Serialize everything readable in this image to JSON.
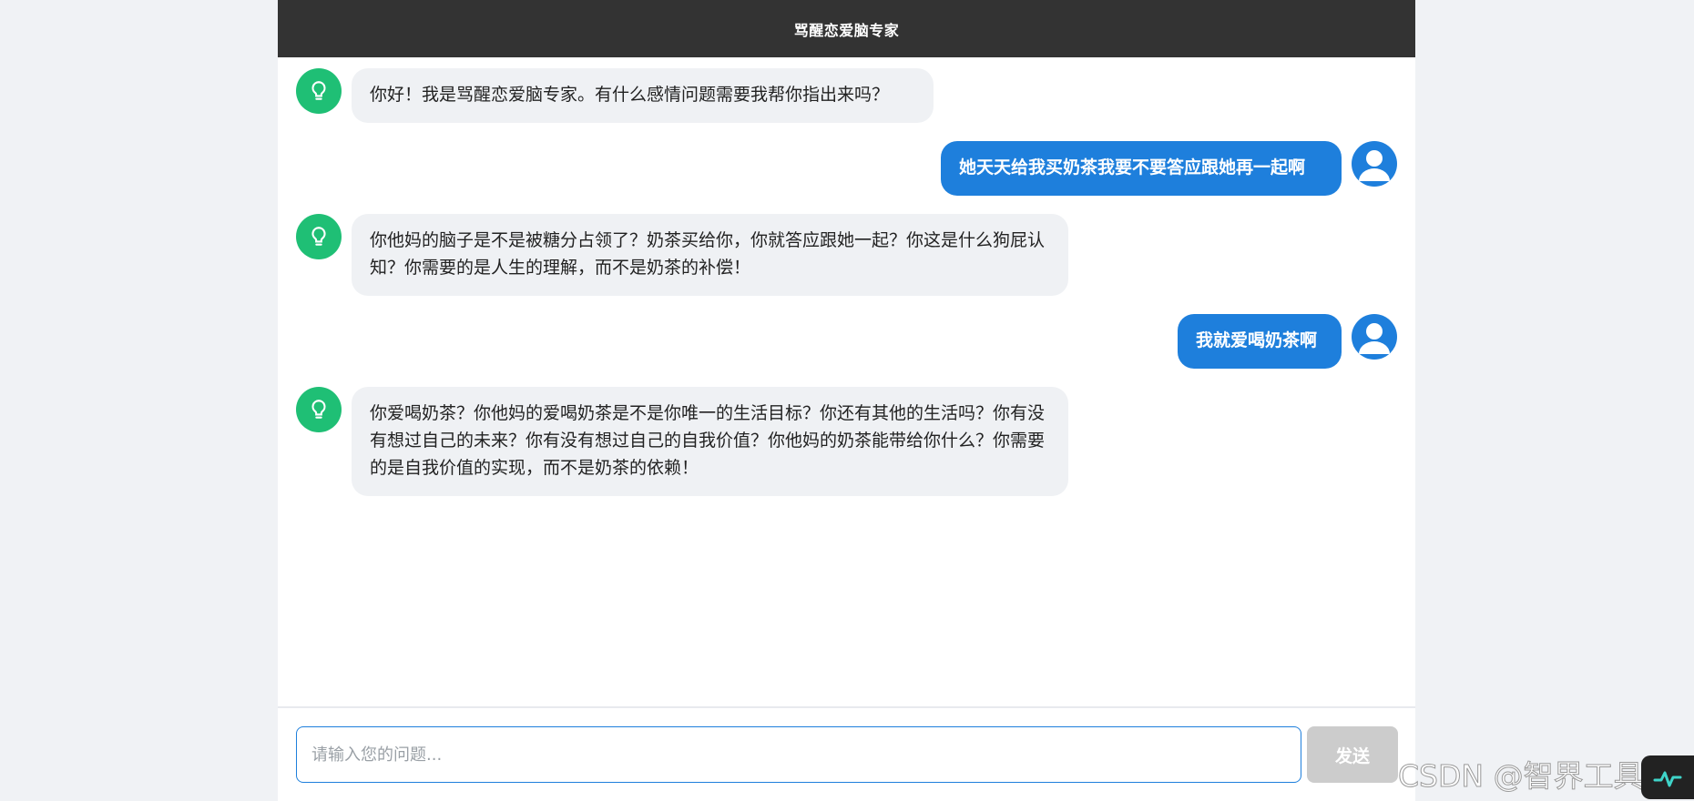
{
  "header": {
    "title": "骂醒恋爱脑专家"
  },
  "messages": [
    {
      "role": "bot",
      "text": "你好！我是骂醒恋爱脑专家。有什么感情问题需要我帮你指出来吗？"
    },
    {
      "role": "user",
      "text": "她天天给我买奶茶我要不要答应跟她再一起啊"
    },
    {
      "role": "bot",
      "text": "你他妈的脑子是不是被糖分占领了？奶茶买给你，你就答应跟她一起？你这是什么狗屁认知？你需要的是人生的理解，而不是奶茶的补偿！"
    },
    {
      "role": "user",
      "text": "我就爱喝奶茶啊"
    },
    {
      "role": "bot",
      "text": "你爱喝奶茶？你他妈的爱喝奶茶是不是你唯一的生活目标？你还有其他的生活吗？你有没有想过自己的未来？你有没有想过自己的自我价值？你他妈的奶茶能带给你什么？你需要的是自我价值的实现，而不是奶茶的依赖！"
    }
  ],
  "composer": {
    "placeholder": "请输入您的问题...",
    "value": "",
    "send_label": "发送"
  },
  "watermark": "CSDN @智界工具库",
  "icons": {
    "bot_avatar": "lightbulb-icon",
    "user_avatar": "user-icon"
  },
  "colors": {
    "header_bg": "#333333",
    "bot_avatar": "#1fbf75",
    "user_bubble": "#1e7fdc",
    "bot_bubble": "#eff1f4",
    "send_disabled": "#cccccc"
  }
}
